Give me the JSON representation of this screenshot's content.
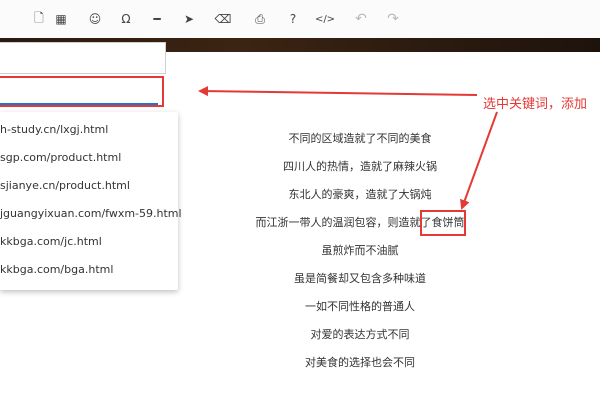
{
  "toolbar": {
    "buttons": [
      {
        "name": "new-document-icon",
        "glyph": "🗋"
      },
      {
        "name": "table-icon",
        "glyph": "▦"
      },
      {
        "name": "emoji-icon",
        "glyph": "☺"
      },
      {
        "name": "omega-icon",
        "glyph": "Ω"
      },
      {
        "name": "horizontal-line-icon",
        "glyph": "━"
      },
      {
        "name": "cursor-icon",
        "glyph": "➤"
      },
      {
        "name": "eraser-icon",
        "glyph": "⌫"
      },
      {
        "name": "print-icon",
        "glyph": "⎙"
      },
      {
        "name": "help-icon",
        "glyph": "?"
      },
      {
        "name": "code-icon",
        "glyph": "</>"
      },
      {
        "name": "undo-icon",
        "glyph": "↶"
      },
      {
        "name": "redo-icon",
        "glyph": "↷"
      }
    ]
  },
  "url_input": {
    "value": ""
  },
  "dropdown": {
    "items": [
      "h-study.cn/lxgj.html",
      "sgp.com/product.html",
      "sjianye.cn/product.html",
      "jguangyixuan.com/fwxm-59.html",
      "kkbga.com/jc.html",
      "kkbga.com/bga.html"
    ]
  },
  "poem": {
    "lines": [
      "不同的区域造就了不同的美食",
      "四川人的热情，造就了麻辣火锅",
      "东北人的豪爽，造就了大锅炖",
      "而江浙一带人的温润包容，则造就了食饼筒",
      "虽煎炸而不油腻",
      "虽是简餐却又包含多种味道",
      "一如不同性格的普通人",
      "对爱的表达方式不同",
      "对美食的选择也会不同"
    ]
  },
  "annotation": {
    "text": "选中关键词，添加"
  },
  "colors": {
    "accent_red": "#e53935",
    "focus_blue": "#1976d2"
  }
}
